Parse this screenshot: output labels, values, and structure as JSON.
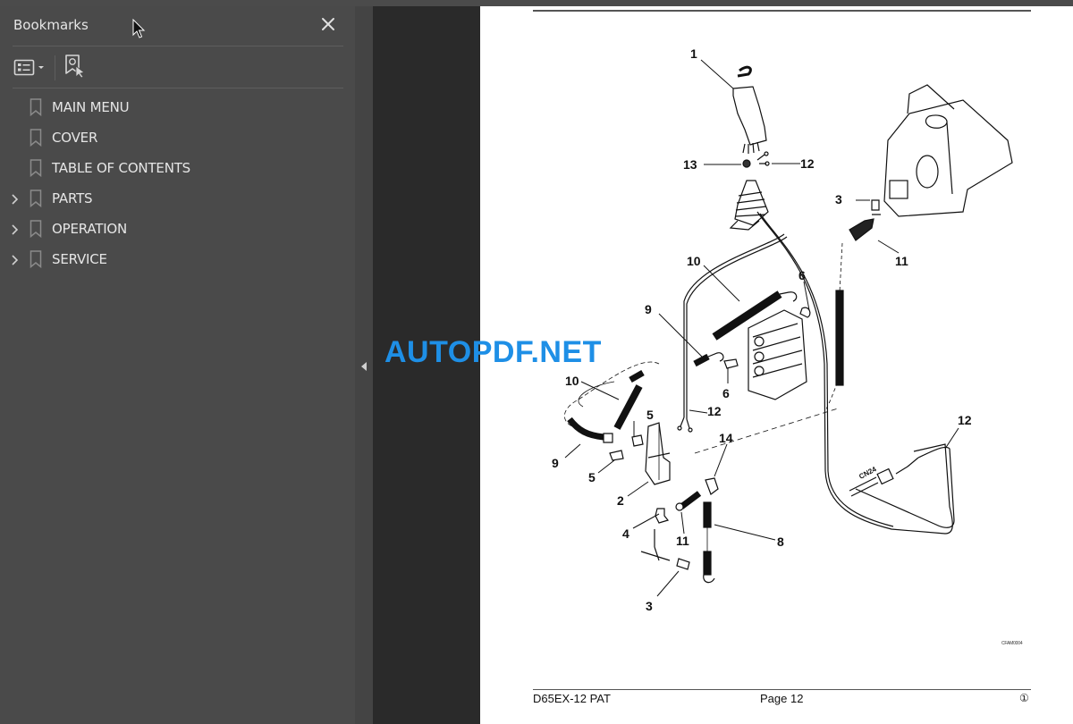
{
  "sidebar": {
    "title": "Bookmarks",
    "close_icon": "close-icon",
    "toolbar": {
      "options_icon": "list-options-icon",
      "find_icon": "find-current-bookmark-icon"
    },
    "items": [
      {
        "label": "MAIN MENU",
        "expandable": false
      },
      {
        "label": "COVER",
        "expandable": false
      },
      {
        "label": "TABLE OF CONTENTS",
        "expandable": false
      },
      {
        "label": "PARTS",
        "expandable": true
      },
      {
        "label": "OPERATION",
        "expandable": true
      },
      {
        "label": "SERVICE",
        "expandable": true
      }
    ]
  },
  "splitter": {
    "icon": "collapse-left-arrow-icon"
  },
  "watermark": "AUTOPDF.NET",
  "page": {
    "diagram_code": "CFAM0004",
    "footer_left": "D65EX-12 PAT",
    "footer_center": "Page 12",
    "footer_right": "①",
    "connector_label": "CN24",
    "callouts": [
      "1",
      "13",
      "12",
      "3",
      "11",
      "10",
      "6",
      "9",
      "6",
      "10",
      "12",
      "5",
      "9",
      "5",
      "2",
      "14",
      "4",
      "11",
      "8",
      "3",
      "12"
    ]
  }
}
